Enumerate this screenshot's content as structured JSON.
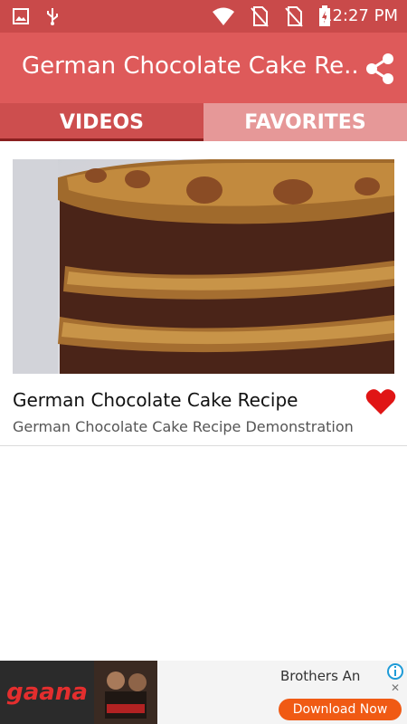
{
  "status_bar": {
    "time": "12:27 PM",
    "icons": [
      "image-icon",
      "usb-icon",
      "wifi-icon",
      "no-sim-icon",
      "no-sim-icon",
      "battery-charging-icon"
    ]
  },
  "app_bar": {
    "title": "German Chocolate Cake Re...",
    "share_icon": "share-icon"
  },
  "tabs": [
    {
      "label": "VIDEOS",
      "selected": true
    },
    {
      "label": "FAVORITES",
      "selected": false
    }
  ],
  "videos": [
    {
      "title": "German Chocolate Cake Recipe",
      "subtitle": "German Chocolate Cake Recipe Demonstration",
      "favorite": true,
      "favorite_icon": "heart-icon"
    }
  ],
  "ad": {
    "logo": "gaana",
    "text": "Brothers An",
    "cta": "Download Now",
    "close": "✕"
  },
  "colors": {
    "status_bar": "#c94a4a",
    "app_bar": "#de5a5a",
    "tab_selected": "#cd4e4e",
    "tab_unselected": "#e69898",
    "heart": "#e01515",
    "ad_cta": "#f05a14"
  }
}
